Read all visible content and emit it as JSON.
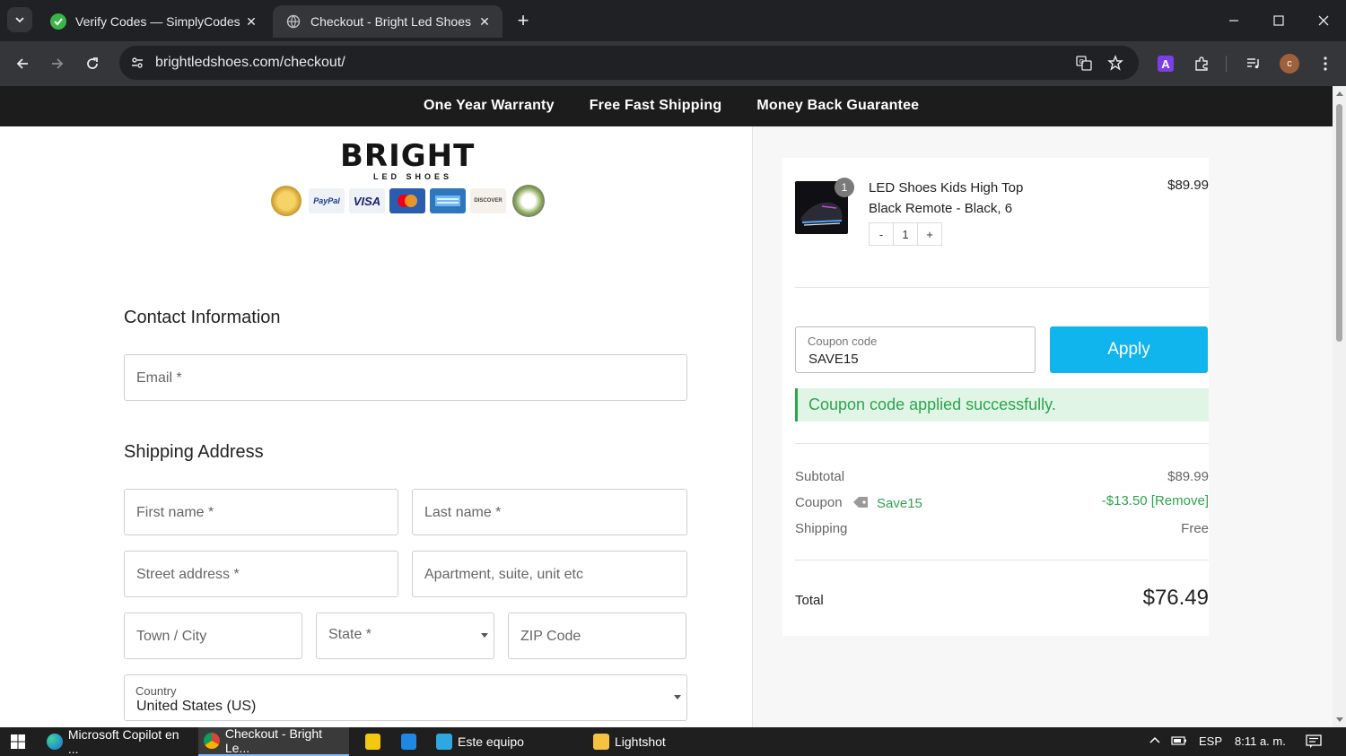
{
  "browser": {
    "tabs": [
      {
        "title": "Verify Codes — SimplyCodes",
        "active": false
      },
      {
        "title": "Checkout - Bright Led Shoes",
        "active": true
      }
    ],
    "url": "brightledshoes.com/checkout/",
    "profile_initial": "c"
  },
  "announcement": {
    "items": [
      "One Year Warranty",
      "Free Fast Shipping",
      "Money Back Guarantee"
    ]
  },
  "logo": {
    "name": "BRIGHT",
    "sub": "LED SHOES",
    "badges": [
      "PayPal",
      "VISA",
      "DISCOVER"
    ]
  },
  "contact": {
    "title": "Contact Information",
    "email_placeholder": "Email *"
  },
  "shipping": {
    "title": "Shipping Address",
    "first_name_placeholder": "First name *",
    "last_name_placeholder": "Last name *",
    "street_placeholder": "Street address *",
    "apartment_placeholder": "Apartment, suite, unit etc",
    "city_placeholder": "Town / City",
    "state_placeholder": "State *",
    "zip_placeholder": "ZIP Code",
    "country_label": "Country",
    "country_value": "United States (US)"
  },
  "order": {
    "product": {
      "name": "LED Shoes Kids High Top Black Remote - Black, 6",
      "price": "$89.99",
      "quantity_badge": "1",
      "qty_minus": "-",
      "qty_value": "1",
      "qty_plus": "+"
    },
    "coupon": {
      "label": "Coupon code",
      "value": "SAVE15",
      "apply_label": "Apply",
      "success_message": "Coupon code applied successfully."
    },
    "summary": {
      "subtotal_label": "Subtotal",
      "subtotal_value": "$89.99",
      "coupon_label": "Coupon",
      "coupon_code": "Save15",
      "coupon_value": "-$13.50 [Remove]",
      "shipping_label": "Shipping",
      "shipping_value": "Free",
      "total_label": "Total",
      "total_value": "$76.49"
    }
  },
  "taskbar": {
    "items": [
      {
        "label": "Microsoft Copilot en ..."
      },
      {
        "label": "Checkout - Bright Le..."
      },
      {
        "label": "Este equipo"
      },
      {
        "label": "Lightshot"
      }
    ],
    "lang": "ESP",
    "time": "8:11 a. m."
  },
  "colors": {
    "accent": "#0fb5ec",
    "success": "#2ea44f",
    "announcement_bg": "#1c1c1c"
  }
}
